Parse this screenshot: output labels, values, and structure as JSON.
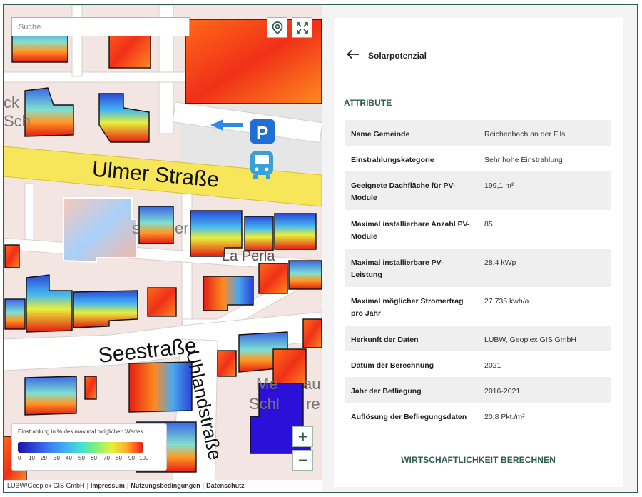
{
  "map": {
    "search_placeholder": "Suche...",
    "labels": {
      "street1": "Ulmer Straße",
      "street2": "Seestraße",
      "street3": "Uhlandstraße",
      "poi": "La Perla",
      "frag_sch": "Sch",
      "frag_ck": "ck",
      "frag_me": "Me",
      "frag_au": "au",
      "frag_schl": "Schl",
      "frag_re": "re",
      "frag_s": "s",
      "frag_er": "er",
      "parking": "P"
    },
    "legend": {
      "title": "Einstrahlung in % des maximal möglichen Wertes",
      "ticks": [
        "0",
        "10",
        "20",
        "30",
        "40",
        "50",
        "60",
        "70",
        "80",
        "90",
        "100"
      ]
    },
    "zoom_in": "+",
    "zoom_out": "−",
    "footer": {
      "source": "LUBW/Geoplex GIS GmbH",
      "imprint": "Impressum",
      "terms": "Nutzungsbedingungen",
      "privacy": "Datenschutz"
    }
  },
  "panel": {
    "title": "Solarpotenzial",
    "section": "ATTRIBUTE",
    "rows": [
      {
        "key": "Name Gemeinde",
        "value": "Reichenbach an der Fils"
      },
      {
        "key": "Einstrahlungskategorie",
        "value": "Sehr hohe Einstrahlung"
      },
      {
        "key": "Geeignete Dachfläche für PV-Module",
        "value": "199,1 m²"
      },
      {
        "key": "Maximal installierbare Anzahl PV-Module",
        "value": "85"
      },
      {
        "key": "Maximal installierbare PV-Leistung",
        "value": "28,4 kWp"
      },
      {
        "key": "Maximal möglicher Stromertrag pro Jahr",
        "value": "27.735 kwh/a"
      },
      {
        "key": "Herkunft der Daten",
        "value": "LUBW, Geoplex GIS GmbH"
      },
      {
        "key": "Datum der Berechnung",
        "value": "2021"
      },
      {
        "key": "Jahr der Befliegung",
        "value": "2016-2021"
      },
      {
        "key": "Auflösung der Befliegungsdaten",
        "value": "20,8 Pkt./m²"
      }
    ],
    "cta": "WIRTSCHAFTLICHKEIT BERECHNEN"
  },
  "colors": {
    "accent": "#2f5d50",
    "road_main": "#f7e65a",
    "parking_blue": "#1f6fd6",
    "bus_blue": "#3aa0d8",
    "selected_roof": "#2a10d8"
  },
  "icons": [
    "back-arrow-icon",
    "location-pin-icon",
    "fullscreen-icon",
    "parking-icon",
    "bus-stop-icon"
  ]
}
